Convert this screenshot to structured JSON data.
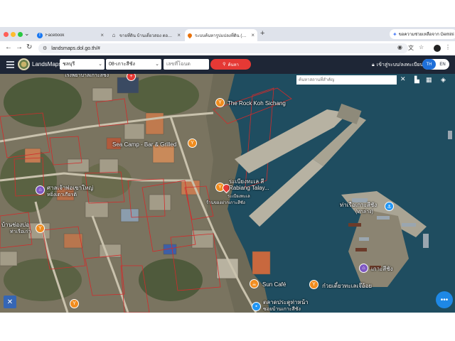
{
  "browser": {
    "tabs": [
      {
        "label": "Facebook",
        "icon": "facebook-icon",
        "active": false
      },
      {
        "label": "ขายที่ดิน บ้านเดี่ยวสอง ตอนใต้ ประ",
        "icon": "home-icon",
        "active": false
      },
      {
        "label": "ระบบค้นหารูปแปลงที่ดิน (Landsl",
        "icon": "location-pin-icon",
        "active": true
      }
    ],
    "new_tab": "+",
    "gemini_label": "ขอความช่วยเหลือจาก Gemini",
    "url": "landsmaps.dol.go.th/#",
    "colors": {
      "tabstrip": "#dfe3eb",
      "facebook": "#1877f2",
      "pin": "#e8710a"
    }
  },
  "app": {
    "brand": "LandsMaps",
    "province": "ชลบุรี",
    "district": "08-เกาะสีชัง",
    "plot_placeholder": "เลขที่โฉนด",
    "search_label": "ค้นหา",
    "login_label": "เข้าสู่ระบบ/ลงทะเบียน",
    "lang_th": "TH",
    "lang_en": "EN",
    "colors": {
      "header": "#1e2636",
      "search": "#e53935",
      "lang_active": "#1e6fd9"
    }
  },
  "map": {
    "place_search_placeholder": "ค้นหาสถานที่สำคัญ",
    "labels": {
      "rock": "The Rock Koh Sichang",
      "seacamp": "Sea Camp - Bar & Grilled",
      "top_cut": "โรงพยาบาลเกาะสีชัง",
      "rabiang_th": "ระเบียงทะเล สี",
      "rabiang_en": "Rabiang Talay...",
      "rabiang_sub": "ระเบียงทะเล",
      "rabiang_sub2": "ร้านของฝากเกาะสีชัง",
      "pier": "ท่าเรือเกาะสีชัง",
      "pier_sub": "(ท่าล่าง)",
      "school1": "ศาลเจ้าพ่อเขาใหญ่",
      "school2": "หยิ่งเตาเกียรติ",
      "left1": "บ้านช่องบ่อ",
      "left2": "ท่าเรือเก่า",
      "kohsichang": "เกาะสีชัง",
      "suncafe": "Sun Café",
      "noodle": "ก๋วยเตี๋ยวทะเลเจ๊อ้อย",
      "market": "ตลาดประตูท่าหน้า",
      "market2": "ซอยบ้านเกาะสีชัง"
    },
    "pin_colors": {
      "orange": "#f08c1e",
      "purple": "#7e57c2",
      "blue": "#2196f3",
      "red": "#e53935"
    }
  }
}
